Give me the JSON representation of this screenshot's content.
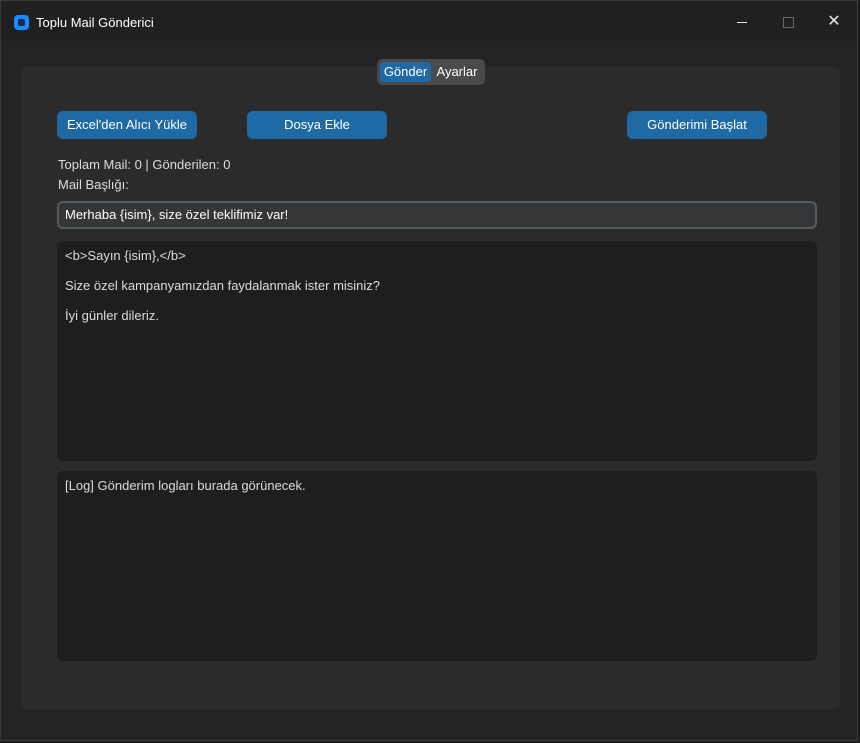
{
  "window": {
    "title": "Toplu Mail Gönderici",
    "icon": "app-icon",
    "controls": {
      "minimize_icon": "minimize-icon",
      "maximize_icon": "maximize-icon",
      "close_symbol": "✕"
    }
  },
  "tabs": [
    {
      "label": "Gönder",
      "selected": true
    },
    {
      "label": "Ayarlar",
      "selected": false
    }
  ],
  "buttons": {
    "load_excel": "Excel'den Alıcı Yükle",
    "attach_file": "Dosya Ekle",
    "start_sending": "Gönderimi Başlat"
  },
  "stats": {
    "text": "Toplam Mail: 0 | Gönderilen: 0"
  },
  "subject": {
    "label": "Mail Başlığı:",
    "value": "Merhaba {isim}, size özel teklifimiz var!"
  },
  "body": {
    "lines": [
      "<b>Sayın {isim},</b>",
      "Size özel kampanyamızdan faydalanmak ister misiniz?",
      "İyi günler dileriz."
    ]
  },
  "log": {
    "lines": [
      "[Log] Gönderim logları burada görünecek."
    ]
  },
  "colors": {
    "accent": "#1f6aa5",
    "background": "#242424",
    "panel": "#2b2b2b",
    "textbox": "#1d1e1e"
  }
}
